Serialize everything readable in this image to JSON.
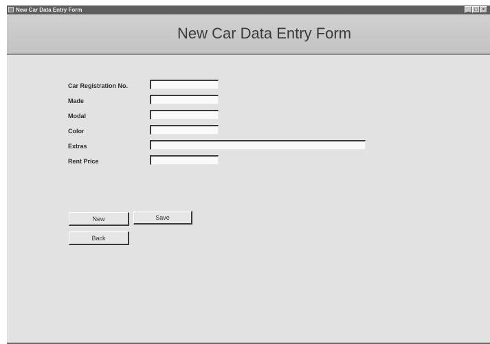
{
  "window": {
    "title": "New Car Data Entry Form",
    "controls": {
      "minimize": "_",
      "maximize": "□",
      "close": "×"
    }
  },
  "header": {
    "title": "New Car Data Entry Form"
  },
  "form": {
    "registration": {
      "label": "Car Registration No.",
      "value": ""
    },
    "made": {
      "label": "Made",
      "value": ""
    },
    "model": {
      "label": "Modal",
      "value": ""
    },
    "color": {
      "label": "Color",
      "value": ""
    },
    "extras": {
      "label": "Extras",
      "value": ""
    },
    "rent_price": {
      "label": "Rent Price",
      "value": ""
    }
  },
  "buttons": {
    "new": "New",
    "save": "Save",
    "back": "Back"
  }
}
